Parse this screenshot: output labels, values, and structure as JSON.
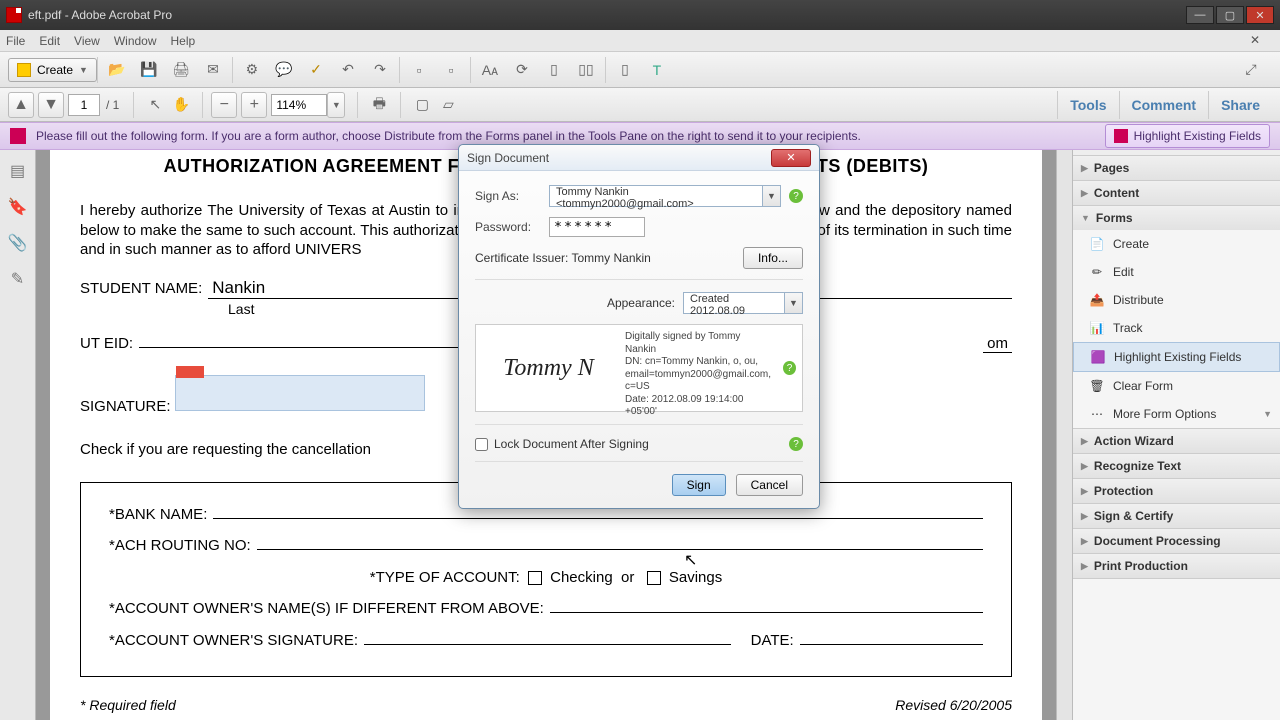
{
  "window": {
    "title": "eft.pdf - Adobe Acrobat Pro"
  },
  "menu": {
    "file": "File",
    "edit": "Edit",
    "view": "View",
    "window": "Window",
    "help": "Help"
  },
  "toolbar": {
    "create": "Create"
  },
  "nav": {
    "page": "1",
    "total": "/ 1",
    "zoom": "114%"
  },
  "links": {
    "tools": "Tools",
    "comment": "Comment",
    "share": "Share"
  },
  "infobar": {
    "msg": "Please fill out the following form. If you are a form author, choose Distribute from the Forms panel in the Tools Pane on the right to send it to your recipients.",
    "highlight": "Highlight Existing Fields"
  },
  "doc": {
    "title_left": "AUTHORIZATION AGREEMENT FOR A",
    "title_right": "ENTS (DEBITS)",
    "body": "I hereby authorize The University of Texas at Austin to initiate debit entries from/to my account indicated below and the depository named below to make the same to such account. This authorization is to remain in force and effect until notified by me of its termination in such time and in such manner as to afford UNIVERS",
    "student_name_lbl": "STUDENT NAME:",
    "student_name_val": "Nankin",
    "last": "Last",
    "uteid_lbl": "UT EID:",
    "right_frag": "om",
    "signature_lbl": "SIGNATURE:",
    "check_line": "Check if you are requesting the cancellation",
    "bank": {
      "name": "*BANK NAME:",
      "routing": "*ACH ROUTING NO:",
      "type": "*TYPE OF ACCOUNT:",
      "checking": "Checking",
      "or": "or",
      "savings": "Savings",
      "owner": "*ACCOUNT OWNER'S NAME(S) IF DIFFERENT FROM ABOVE:",
      "ownersig": "*ACCOUNT OWNER'S SIGNATURE:",
      "date": "DATE:"
    },
    "footer_left": "* Required field",
    "footer_right": "Revised 6/20/2005"
  },
  "panel": {
    "pages": "Pages",
    "content": "Content",
    "forms": "Forms",
    "items": {
      "create": "Create",
      "edit": "Edit",
      "distribute": "Distribute",
      "track": "Track",
      "highlight": "Highlight Existing Fields",
      "clear": "Clear Form",
      "more": "More Form Options"
    },
    "action": "Action Wizard",
    "recognize": "Recognize Text",
    "protection": "Protection",
    "sign": "Sign & Certify",
    "docproc": "Document Processing",
    "print": "Print Production"
  },
  "dialog": {
    "title": "Sign Document",
    "signas_lbl": "Sign As:",
    "signas_val": "Tommy Nankin <tommyn2000@gmail.com>",
    "password_lbl": "Password:",
    "password_val": "******",
    "cert_lbl": "Certificate Issuer: Tommy Nankin",
    "info": "Info...",
    "appearance_lbl": "Appearance:",
    "appearance_val": "Created 2012.08.09",
    "sig_name": "Tommy N",
    "sig_text": "Digitally signed by Tommy Nankin\nDN: cn=Tommy Nankin, o, ou, email=tommyn2000@gmail.com, c=US\nDate: 2012.08.09 19:14:00 +05'00'",
    "lock": "Lock Document After Signing",
    "sign_btn": "Sign",
    "cancel_btn": "Cancel"
  }
}
